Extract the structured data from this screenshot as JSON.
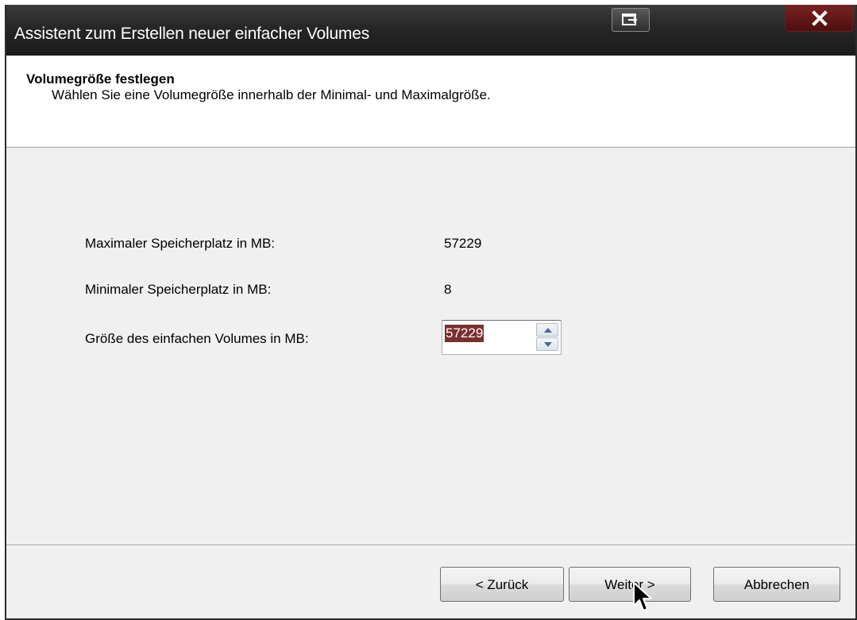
{
  "window": {
    "title": "Assistent zum Erstellen neuer einfacher Volumes"
  },
  "header": {
    "title": "Volumegröße festlegen",
    "subtitle": "Wählen Sie eine Volumegröße innerhalb der Minimal- und Maximalgröße."
  },
  "fields": {
    "max_label": "Maximaler Speicherplatz in MB:",
    "max_value": "57229",
    "min_label": "Minimaler Speicherplatz in MB:",
    "min_value": "8",
    "size_label": "Größe des einfachen Volumes in MB:",
    "size_value": "57229"
  },
  "buttons": {
    "back": "< Zurück",
    "next": "Weiter >",
    "cancel": "Abbrechen"
  },
  "colors": {
    "titlebar": "#262626",
    "close_button": "#6b1a1a",
    "selection": "#7a2f2f"
  },
  "icons": {
    "restore": "restore-icon",
    "close": "close-icon",
    "spin_up": "arrow-up-icon",
    "spin_down": "arrow-down-icon",
    "cursor": "mouse-pointer-icon"
  }
}
